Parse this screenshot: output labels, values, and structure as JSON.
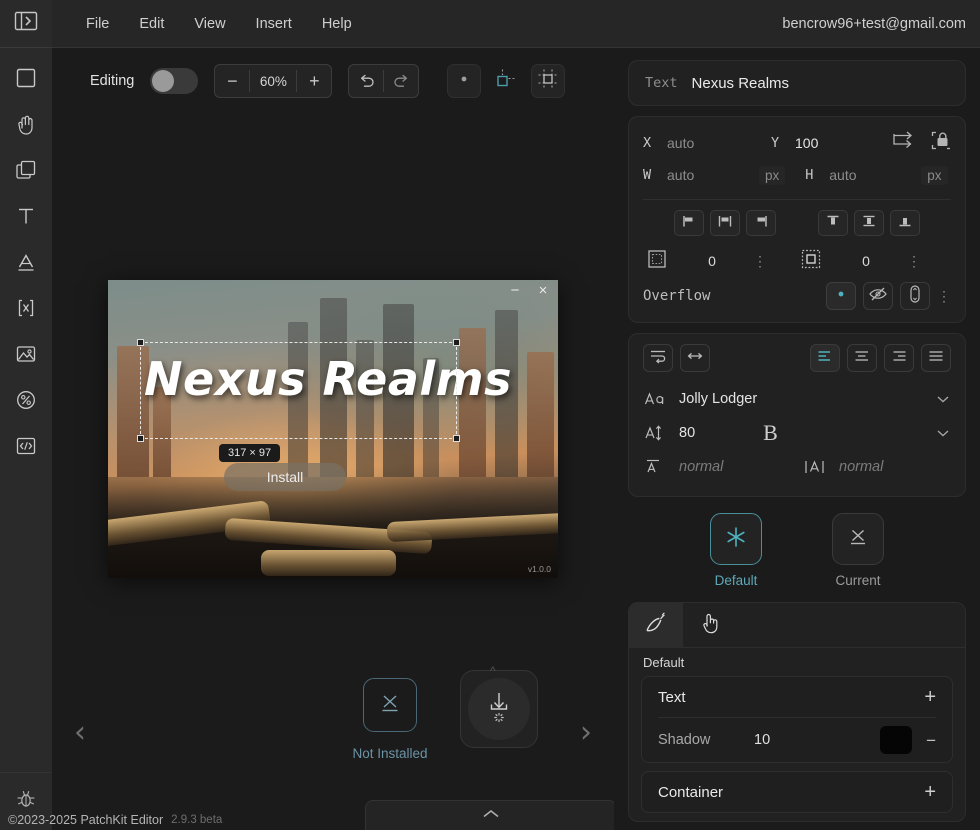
{
  "app": {
    "footer_copyright": "©2023-2025 PatchKit Editor",
    "footer_version": "2.9.3 beta"
  },
  "menubar": {
    "items": [
      {
        "label": "File"
      },
      {
        "label": "Edit"
      },
      {
        "label": "View"
      },
      {
        "label": "Insert"
      },
      {
        "label": "Help"
      }
    ],
    "account_email": "bencrow96+test@gmail.com"
  },
  "toolbar": {
    "editing_label": "Editing",
    "editing_on": false,
    "zoom_minus": "−",
    "zoom_value": "60%",
    "zoom_plus": "+",
    "undo": "↶",
    "redo": "↷",
    "snap_point": "snap-point-icon",
    "snap_object": "snap-object-icon",
    "snap_grid": "snap-grid-icon"
  },
  "left_rail": {
    "panel_toggle": "panel-expand-icon",
    "tools": [
      {
        "name": "rectangle-tool",
        "glyph": "rectangle"
      },
      {
        "name": "hand-tool",
        "glyph": "hand"
      },
      {
        "name": "duplicate-tool",
        "glyph": "copy"
      },
      {
        "name": "text-tool",
        "glyph": "T"
      },
      {
        "name": "font-tool",
        "glyph": "A"
      },
      {
        "name": "variable-tool",
        "glyph": "[X]"
      },
      {
        "name": "image-tool",
        "glyph": "image"
      },
      {
        "name": "progress-tool",
        "glyph": "percent"
      },
      {
        "name": "code-tool",
        "glyph": "code"
      }
    ],
    "debug": "bug-icon"
  },
  "canvas": {
    "preview": {
      "game_title": "Nexus Realms",
      "install_button": "Install",
      "dimension_badge": "317 × 97",
      "version_tag": "v1.0.0",
      "minimize": "−",
      "close": "×"
    },
    "nav_prev": "‹",
    "nav_next": "›",
    "status_text": "Not Installed",
    "status_icon": "x-placeholder-icon",
    "download_icon": "download-icon",
    "drawer_caret": "chevron-up-icon"
  },
  "inspector": {
    "text_card": {
      "label": "Text",
      "value": "Nexus Realms"
    },
    "geometry": {
      "x_label": "X",
      "x_value": "auto",
      "y_label": "Y",
      "y_value": "100",
      "w_label": "W",
      "w_value": "auto",
      "w_unit": "px",
      "h_label": "H",
      "h_value": "auto",
      "h_unit": "px",
      "anchor_icon": "anchor-corner-icon",
      "lock_icon": "aspect-lock-icon",
      "align_h": [
        {
          "name": "align-left-icon"
        },
        {
          "name": "align-center-horizontal-icon"
        },
        {
          "name": "align-right-icon"
        }
      ],
      "align_v": [
        {
          "name": "align-top-icon"
        },
        {
          "name": "align-middle-vertical-icon"
        },
        {
          "name": "align-bottom-icon"
        }
      ],
      "padding_icon": "padding-icon",
      "padding_value": "0",
      "margin_icon": "margin-icon",
      "margin_value": "0",
      "overflow_label": "Overflow",
      "overflow_options": [
        {
          "name": "overflow-visible-icon",
          "active": true
        },
        {
          "name": "overflow-hidden-icon",
          "active": false
        },
        {
          "name": "overflow-scroll-icon",
          "active": false
        }
      ],
      "kebab": "⋮"
    },
    "typography": {
      "wrap_icon": "text-wrap-icon",
      "stretch_icon": "text-stretch-icon",
      "align_options": [
        {
          "name": "text-align-left-icon",
          "active": true
        },
        {
          "name": "text-align-center-icon",
          "active": false
        },
        {
          "name": "text-align-right-icon",
          "active": false
        },
        {
          "name": "text-align-justify-icon",
          "active": false
        }
      ],
      "font_icon": "font-family-icon",
      "font_family": "Jolly Lodger",
      "size_icon": "font-size-icon",
      "font_size": "80",
      "weight_icon": "font-weight-icon",
      "weight_glyph": "B",
      "line_icon": "line-height-icon",
      "line_height": "normal",
      "letter_icon": "letter-spacing-icon",
      "letter_spacing": "normal",
      "chevron": "⌄"
    },
    "states": [
      {
        "label": "Default",
        "icon": "asterisk-icon",
        "selected": true
      },
      {
        "label": "Current",
        "icon": "x-placeholder-icon",
        "selected": false
      }
    ],
    "styles": {
      "tabs": [
        {
          "name": "brush-tab",
          "icon": "brush-icon",
          "active": true
        },
        {
          "name": "pointer-tab",
          "icon": "pointer-hand-icon",
          "active": false
        }
      ],
      "subtitle": "Default",
      "groups": [
        {
          "title": "Text",
          "add": "+",
          "rows": [
            {
              "name": "Shadow",
              "value": "10",
              "color": "#050505",
              "remove": "−"
            }
          ]
        },
        {
          "title": "Container",
          "add": "+",
          "rows": []
        }
      ]
    }
  },
  "colors": {
    "accent": "#5fa8b8",
    "panel": "#212121",
    "background": "#1b1b1b",
    "rail": "#2a2a2a"
  }
}
